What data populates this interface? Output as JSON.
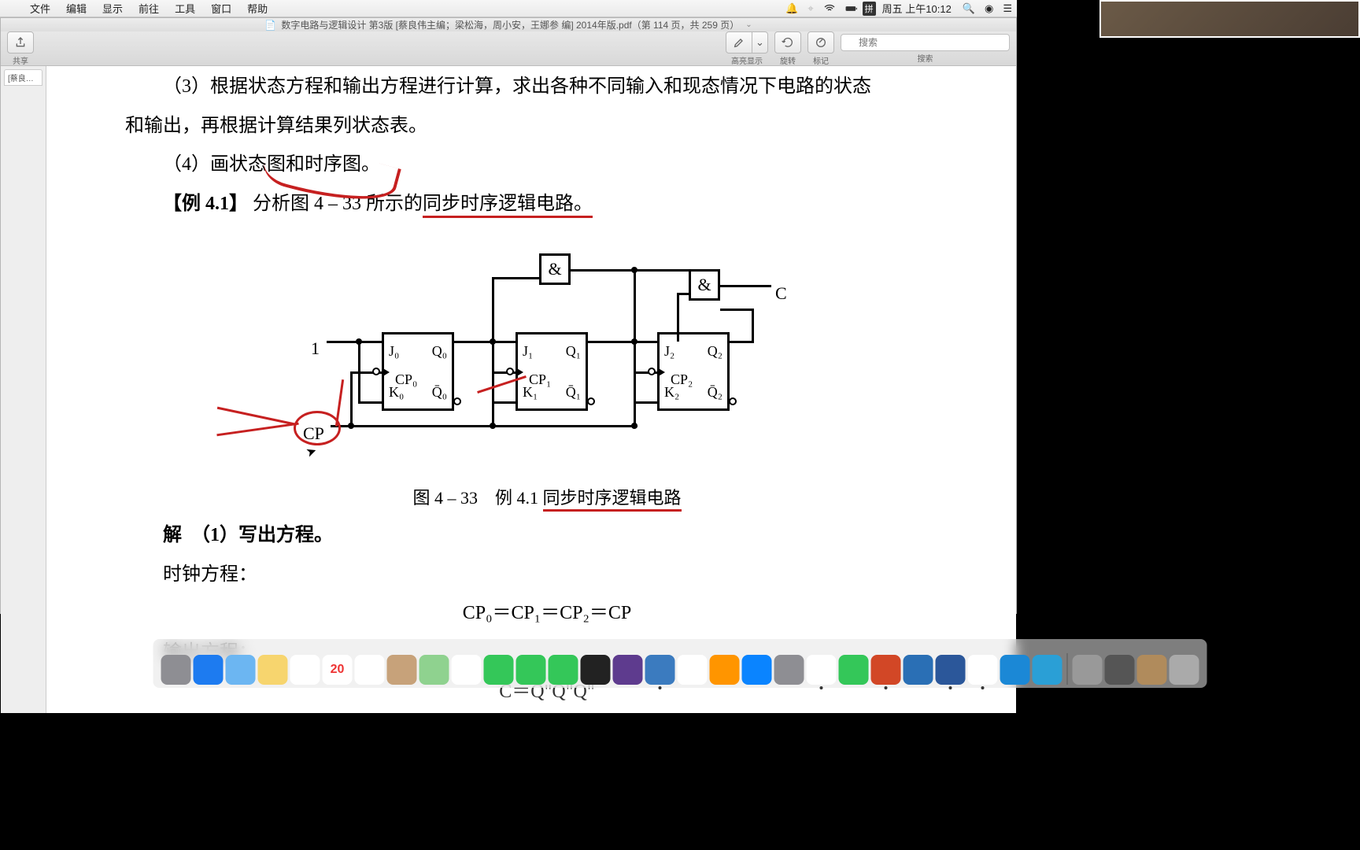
{
  "menubar": {
    "apple": "",
    "items": [
      "文件",
      "编辑",
      "显示",
      "前往",
      "工具",
      "窗口",
      "帮助"
    ],
    "input_icon": "拼",
    "clock": "周五 上午10:12"
  },
  "window": {
    "title": "数字电路与逻辑设计 第3版 [蔡良伟主编；梁松海，周小安，王娜参 编] 2014年版.pdf（第 114 页，共 259 页）",
    "sidebar_tab": "[蔡良伟..."
  },
  "toolbar": {
    "share": "共享",
    "highlight": "高亮显示",
    "rotate": "旋转",
    "markup": "标记",
    "search_placeholder": "搜索",
    "search_label": "搜索"
  },
  "doc": {
    "line_top": "（3）根据状态方程和输出方程进行计算，求出各种不同输入和现态情况下电路的状态",
    "line_top2": "和输出，再根据计算结果列状态表。",
    "step4": "（4）画状态图和时序图。",
    "example_label": "【例 4.1】",
    "example_text_a": "分析图 4 – 33 所示的",
    "example_text_b": "同步时序逻辑电路。",
    "caption_a": "图 4 – 33　例 4.1 ",
    "caption_b": "同步时序逻辑电路",
    "solve": "解　（1）写出方程。",
    "clock_eq_label": "时钟方程：",
    "clock_eq": "CP₀＝CP₁＝CP₂＝CP",
    "output_eq_label": "输出方程：",
    "output_partial": "C＝Q\"Q\"Q\""
  },
  "circuit": {
    "input1": "1",
    "cp": "CP",
    "and": "&",
    "outC": "C",
    "ff": [
      {
        "J": "J₀",
        "Q": "Q₀",
        "CP": "CP₀",
        "K": "K₀",
        "Qb": "Q̄₀"
      },
      {
        "J": "J₁",
        "Q": "Q₁",
        "CP": "CP₁",
        "K": "K₁",
        "Qb": "Q̄₁"
      },
      {
        "J": "J₂",
        "Q": "Q₂",
        "CP": "CP₂",
        "K": "K₂",
        "Qb": "Q̄₂"
      }
    ]
  },
  "dock": {
    "items": [
      {
        "name": "launchpad",
        "bg": "#8e8e93"
      },
      {
        "name": "safari",
        "bg": "#1d7bf0"
      },
      {
        "name": "folder",
        "bg": "#6cb6f2"
      },
      {
        "name": "notes",
        "bg": "#f7d56e"
      },
      {
        "name": "reminders",
        "bg": "#fff"
      },
      {
        "name": "calendar",
        "bg": "#fff",
        "text": "20"
      },
      {
        "name": "photos",
        "bg": "#fff"
      },
      {
        "name": "contacts",
        "bg": "#c7a27a"
      },
      {
        "name": "maps",
        "bg": "#8fd28f"
      },
      {
        "name": "mail",
        "bg": "#fff"
      },
      {
        "name": "messages",
        "bg": "#34c759"
      },
      {
        "name": "facetime",
        "bg": "#34c759"
      },
      {
        "name": "findmy",
        "bg": "#34c759"
      },
      {
        "name": "siri",
        "bg": "#222"
      },
      {
        "name": "imovie",
        "bg": "#5e3b8e"
      },
      {
        "name": "preview",
        "bg": "#3b7bbf",
        "running": true
      },
      {
        "name": "music",
        "bg": "#fff"
      },
      {
        "name": "books",
        "bg": "#ff9500"
      },
      {
        "name": "appstore",
        "bg": "#0a84ff"
      },
      {
        "name": "settings",
        "bg": "#8e8e93"
      },
      {
        "name": "chrome",
        "bg": "#fff",
        "running": true
      },
      {
        "name": "numbers",
        "bg": "#34c759"
      },
      {
        "name": "powerpoint",
        "bg": "#d24726",
        "running": true
      },
      {
        "name": "mindmap",
        "bg": "#2a6fb5"
      },
      {
        "name": "word",
        "bg": "#2b579a",
        "running": true
      },
      {
        "name": "qq",
        "bg": "#fff",
        "running": true
      },
      {
        "name": "xcode",
        "bg": "#1b88d6"
      },
      {
        "name": "wps",
        "bg": "#2a9fd6"
      }
    ],
    "right": [
      {
        "name": "download1",
        "bg": "#999"
      },
      {
        "name": "download2",
        "bg": "#555"
      },
      {
        "name": "stack",
        "bg": "#b08b5c"
      },
      {
        "name": "trash",
        "bg": "#aaa"
      }
    ]
  }
}
